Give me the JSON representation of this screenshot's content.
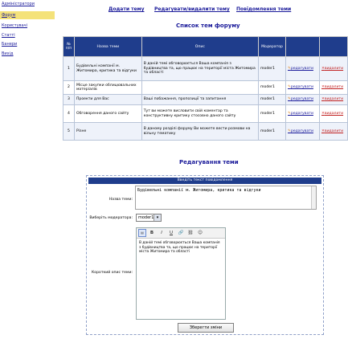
{
  "sidebar": {
    "items": [
      {
        "label": "Адміністратори"
      },
      {
        "label": "Форум"
      },
      {
        "label": "Користувачі"
      },
      {
        "label": "Статті"
      },
      {
        "label": "Банери"
      },
      {
        "label": "Вихід"
      }
    ]
  },
  "topnav": {
    "add_topic": "Додати тему",
    "edit_delete_topic": "Редагувати/видалити тему",
    "topic_messages": "Повідомлення теми"
  },
  "list_title": "Список тем форуму",
  "table": {
    "headers": {
      "num": "№ п/п",
      "name": "Назва теми",
      "desc": "Опис",
      "moderator": "Модератор"
    },
    "rows": [
      {
        "num": "1",
        "name": "Будівельні компанії м. Житомира, критика та відгуки",
        "desc": "В даній темі обговорюється Ваша компанія з будівництва та, що працює на території міста Житомира та області",
        "moderator": "moder1",
        "edit": "редагувати",
        "delete": "видалити"
      },
      {
        "num": "2",
        "name": "Місце закупки облицювальних матеріалів",
        "desc": "",
        "moderator": "moder1",
        "edit": "редагувати",
        "delete": "видалити"
      },
      {
        "num": "3",
        "name": "Проекти для Вас",
        "desc": "Ваші побажання, пропозиції та запитання",
        "moderator": "moder1",
        "edit": "редагувати",
        "delete": "видалити"
      },
      {
        "num": "4",
        "name": "Обговорення даного сайту",
        "desc": "Тут ви можете висловити свій коментар та конструктивну критику стосовно даного сайту",
        "moderator": "moder1",
        "edit": "редагувати",
        "delete": "видалити"
      },
      {
        "num": "5",
        "name": "Різне",
        "desc": "В даному розділі форуму Ви можете вести розмови на вільну тематику",
        "moderator": "moder1",
        "edit": "редагувати",
        "delete": "видалити"
      }
    ]
  },
  "edit_title": "Редагування теми",
  "form": {
    "header": "Введіть текст повідомлення",
    "name_label": "Назва теми:",
    "name_value": "Будівельні компанії м. Житомира, критика та відгуки",
    "moderator_label": "Виберіть модератора:",
    "moderator_value": "moder1",
    "description_label": "Короткий опис теми:",
    "description_value": "В даній темі обговорюється Ваша компанія з будівництва та, що працює на території міста Житомира та області",
    "toolbar": {
      "bold": "B",
      "italic": "I",
      "underline": "U",
      "link": "🔗",
      "unlink": "⛓",
      "emoticon": "☺"
    },
    "submit_label": "Зберегти зміни"
  },
  "colors": {
    "header_bg": "#1f3d8c",
    "link": "#1a1a9a",
    "active_sidebar": "#f4e27a",
    "delete": "#c02020"
  }
}
